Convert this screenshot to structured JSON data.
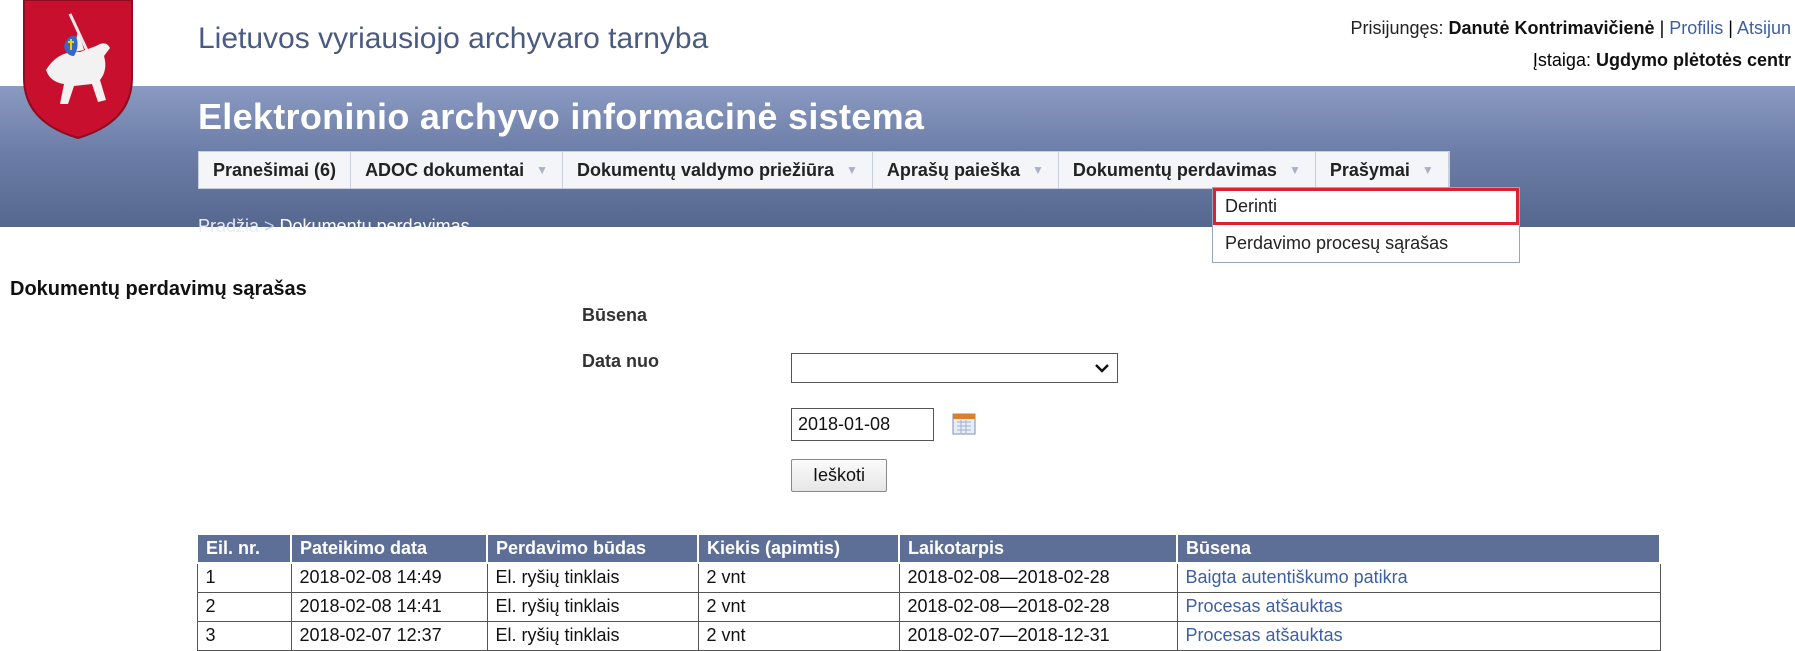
{
  "header": {
    "org_name": "Lietuvos vyriausiojo archyvaro tarnyba",
    "top_cut_text": "...",
    "login_label": "Prisijungęs: ",
    "user_name": "Danutė Kontrimavičienė",
    "sep1": " | ",
    "profile_link": "Profilis",
    "sep2": " | ",
    "logout_link": "Atsijun",
    "institution_label": "Įstaiga: ",
    "institution_name": "Ugdymo plėtotės centr",
    "system_title": "Elektroninio archyvo informacinė sistema"
  },
  "menu": {
    "items": [
      {
        "label": "Pranešimai (6)",
        "has_arrow": false
      },
      {
        "label": "ADOC dokumentai",
        "has_arrow": true
      },
      {
        "label": "Dokumentų valdymo priežiūra",
        "has_arrow": true
      },
      {
        "label": "Aprašų paieška",
        "has_arrow": true
      },
      {
        "label": "Dokumentų perdavimas",
        "has_arrow": true
      },
      {
        "label": "Prašymai",
        "has_arrow": true
      }
    ],
    "dropdown": [
      "Derinti",
      "Perdavimo procesų sąrašas"
    ]
  },
  "breadcrumb": {
    "home": "Pradžia",
    "separator": ">",
    "current": "Dokumentų perdavimas"
  },
  "page_title": "Dokumentų perdavimų sąrašas",
  "form": {
    "status_label": "Būsena",
    "status_value": "",
    "date_from_label": "Data nuo",
    "date_from_value": "2018-01-08",
    "search_button": "Ieškoti"
  },
  "table": {
    "headers": [
      "Eil. nr.",
      "Pateikimo data",
      "Perdavimo būdas",
      "Kiekis (apimtis)",
      "Laikotarpis",
      "Būsena"
    ],
    "rows": [
      [
        "1",
        "2018-02-08 14:49",
        "El. ryšių tinklais",
        "2 vnt",
        "2018-02-08—2018-02-28",
        "Baigta autentiškumo patikra"
      ],
      [
        "2",
        "2018-02-08 14:41",
        "El. ryšių tinklais",
        "2 vnt",
        "2018-02-08—2018-02-28",
        "Procesas atšauktas"
      ],
      [
        "3",
        "2018-02-07 12:37",
        "El. ryšių tinklais",
        "2 vnt",
        "2018-02-07—2018-12-31",
        "Procesas atšauktas"
      ]
    ]
  },
  "colors": {
    "band": "#6d7ea8",
    "table_header": "#5e6f97",
    "link": "#3d5fa3",
    "highlight": "#d9232f"
  }
}
